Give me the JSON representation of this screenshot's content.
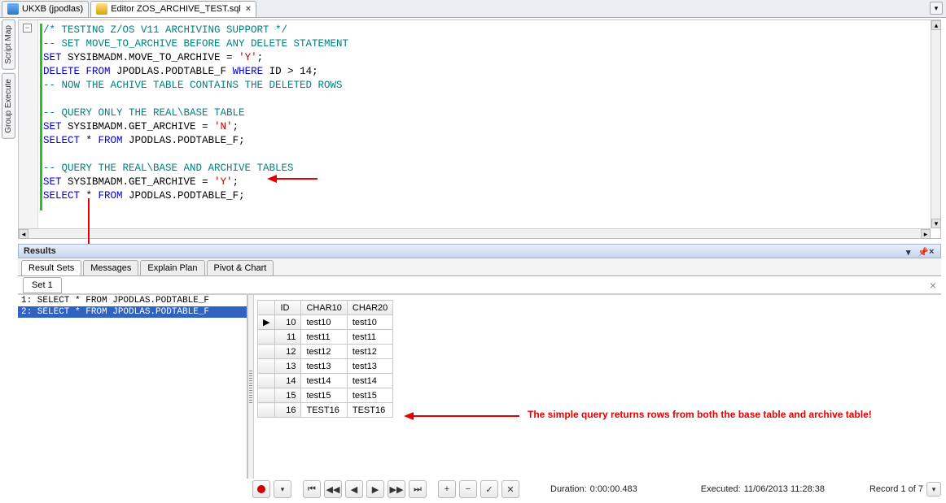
{
  "tabs": {
    "db": "UKXB (jpodlas)",
    "editor": "Editor ZOS_ARCHIVE_TEST.sql"
  },
  "side": {
    "scriptmap": "Script Map",
    "groupexec": "Group Execute"
  },
  "code": {
    "l1a": "/* TESTING Z/OS V11 ARCHIVING SUPPORT */",
    "l2a": "-- SET MOVE_TO_ARCHIVE BEFORE ANY DELETE STATEMENT",
    "l3_kw1": "SET",
    "l3_id": " SYSIBMADM.MOVE_TO_ARCHIVE = ",
    "l3_str": "'Y'",
    "l3_end": ";",
    "l4_kw1": "DELETE ",
    "l4_kw2": "FROM",
    "l4_id1": " JPODLAS.PODTABLE_F ",
    "l4_kw3": "WHERE",
    "l4_id2": " ID > ",
    "l4_num": "14",
    "l4_end": ";",
    "l5a": "-- NOW THE ACHIVE TABLE CONTAINS THE DELETED ROWS",
    "l7a": "-- QUERY ONLY THE REAL\\BASE TABLE",
    "l8_kw1": "SET",
    "l8_id": " SYSIBMADM.GET_ARCHIVE = ",
    "l8_str": "'N'",
    "l8_end": ";",
    "l9_kw1": "SELECT",
    "l9_star": " * ",
    "l9_kw2": "FROM",
    "l9_id": " JPODLAS.PODTABLE_F;",
    "l11a": "-- QUERY THE REAL\\BASE AND ARCHIVE TABLES",
    "l12_kw1": "SET",
    "l12_id": " SYSIBMADM.GET_ARCHIVE = ",
    "l12_str": "'Y'",
    "l12_end": ";",
    "l13_kw1": "SELECT",
    "l13_star": " * ",
    "l13_kw2": "FROM",
    "l13_id": " JPODLAS.PODTABLE_F;"
  },
  "results": {
    "panel_title": "Results",
    "tabs": [
      "Result Sets",
      "Messages",
      "Explain Plan",
      "Pivot & Chart"
    ],
    "set_tab": "Set 1",
    "queries": [
      "1: SELECT * FROM JPODLAS.PODTABLE_F",
      "2: SELECT * FROM JPODLAS.PODTABLE_F"
    ],
    "columns": [
      "ID",
      "CHAR10",
      "CHAR20"
    ],
    "rows": [
      {
        "id": "10",
        "c1": "test10",
        "c2": "test10"
      },
      {
        "id": "11",
        "c1": "test11",
        "c2": "test11"
      },
      {
        "id": "12",
        "c1": "test12",
        "c2": "test12"
      },
      {
        "id": "13",
        "c1": "test13",
        "c2": "test13"
      },
      {
        "id": "14",
        "c1": "test14",
        "c2": "test14"
      },
      {
        "id": "15",
        "c1": "test15",
        "c2": "test15"
      },
      {
        "id": "16",
        "c1": "TEST16",
        "c2": "TEST16"
      }
    ]
  },
  "status": {
    "duration_label": "Duration: ",
    "duration": "0:00:00.483",
    "executed_label": "Executed: ",
    "executed": "11/06/2013 11:28:38",
    "record": "Record 1 of 7"
  },
  "annot": {
    "bottom": "The simple query returns rows from both the base table and archive table!"
  },
  "glyph": {
    "close": "×",
    "dd": "▾",
    "first": "⏮",
    "prev": "◀",
    "next": "▶",
    "last": "⏭",
    "plus": "+",
    "minus": "−",
    "check": "✓",
    "x": "✕",
    "left": "◂",
    "right": "▸",
    "up": "▴",
    "down": "▾",
    "prevpage": "◀◀",
    "nextpage": "▶▶",
    "play": "▶"
  }
}
